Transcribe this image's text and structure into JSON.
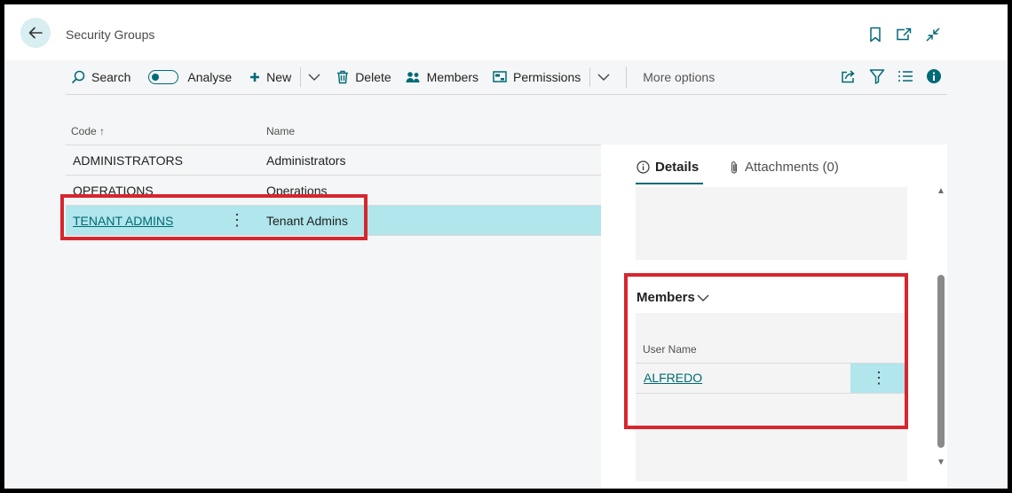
{
  "header": {
    "title": "Security Groups",
    "icons": [
      "back-arrow-icon",
      "bookmark-icon",
      "open-new-window-icon",
      "collapse-icon"
    ]
  },
  "toolbar": {
    "search_label": "Search",
    "analyse_label": "Analyse",
    "new_label": "New",
    "delete_label": "Delete",
    "members_label": "Members",
    "permissions_label": "Permissions",
    "more_options_label": "More options",
    "right_icons": [
      "share-icon",
      "filter-icon",
      "list-view-icon",
      "info-icon"
    ]
  },
  "list": {
    "columns": {
      "code": "Code ↑",
      "name": "Name"
    },
    "rows": [
      {
        "code": "ADMINISTRATORS",
        "name": "Administrators",
        "selected": false
      },
      {
        "code": "OPERATIONS",
        "name": "Operations",
        "selected": false
      },
      {
        "code": "TENANT ADMINS",
        "name": "Tenant Admins",
        "selected": true
      }
    ]
  },
  "factbox": {
    "tabs": {
      "details": "Details",
      "attachments": "Attachments (0)"
    },
    "members": {
      "title": "Members",
      "column": "User Name",
      "rows": [
        {
          "user_name": "ALFREDO"
        }
      ]
    }
  },
  "colors": {
    "accent": "#006a75",
    "selection": "#b0e6ec",
    "highlight": "#d7262e"
  }
}
